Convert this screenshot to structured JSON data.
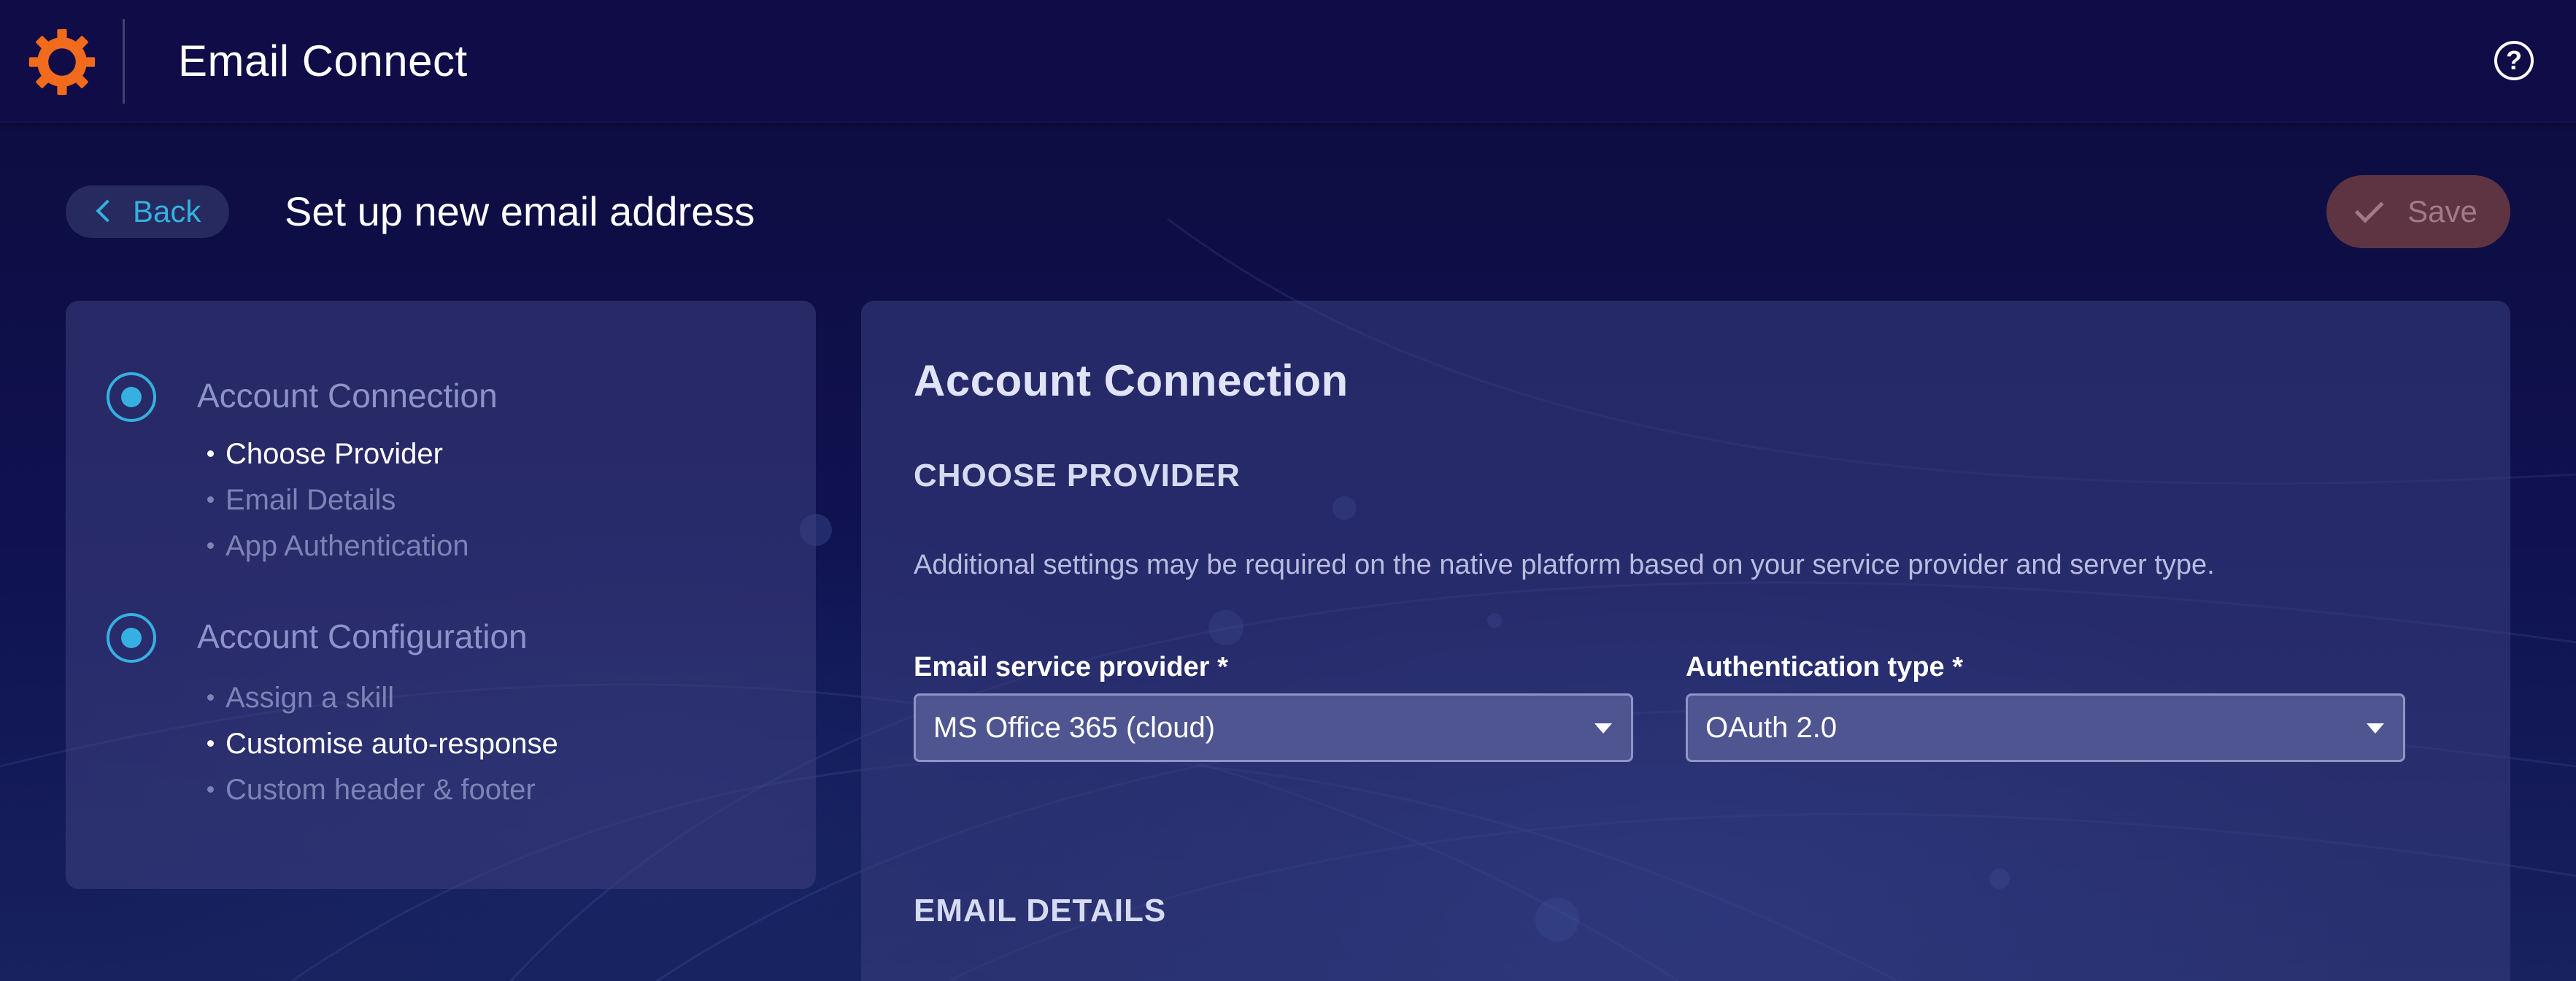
{
  "header": {
    "app_title": "Email Connect",
    "logo_icon": "orange-gear-logo",
    "help_icon": "question-circle-icon",
    "help_glyph": "?"
  },
  "page": {
    "back_label": "Back",
    "title": "Set up new email address",
    "save_label": "Save"
  },
  "stepper": {
    "steps": [
      {
        "title": "Account Connection",
        "items": [
          {
            "label": "Choose Provider",
            "active": true
          },
          {
            "label": "Email Details",
            "active": false
          },
          {
            "label": "App Authentication",
            "active": false
          }
        ]
      },
      {
        "title": "Account Configuration",
        "items": [
          {
            "label": "Assign a skill",
            "active": false
          },
          {
            "label": "Customise auto-response",
            "active": true
          },
          {
            "label": "Custom header & footer",
            "active": false
          }
        ]
      }
    ]
  },
  "content": {
    "heading": "Account Connection",
    "choose_provider_heading": "CHOOSE PROVIDER",
    "help_text": "Additional settings may be required on the native platform based on your service provider and server type.",
    "provider": {
      "label": "Email service provider *",
      "value": "MS Office 365 (cloud)"
    },
    "auth": {
      "label": "Authentication type *",
      "value": "OAuth 2.0"
    },
    "email_details_heading": "EMAIL DETAILS"
  },
  "colors": {
    "accent": "#35b0e0",
    "brand_orange": "#f26b1d",
    "topbar": "#0f0c47",
    "save_disabled": "#5f3442"
  }
}
